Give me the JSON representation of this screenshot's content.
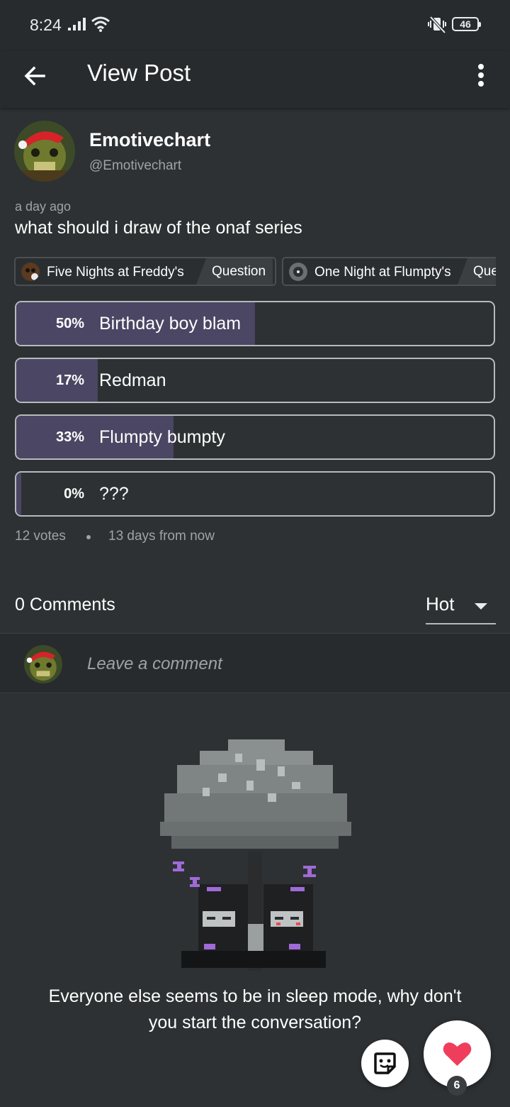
{
  "status_bar": {
    "time": "8:24",
    "battery": "46"
  },
  "appbar": {
    "title": "View Post"
  },
  "author": {
    "name": "Emotivechart",
    "handle": "@Emotivechart"
  },
  "post": {
    "time_ago": "a day ago",
    "title": "what should i draw of the onaf series"
  },
  "tags": [
    {
      "name": "Five Nights at Freddy's",
      "category": "Question"
    },
    {
      "name": "One Night at Flumpty's",
      "category": "Question"
    }
  ],
  "poll": {
    "options": [
      {
        "percent_label": "50%",
        "label": "Birthday boy blam",
        "fraction": 0.5
      },
      {
        "percent_label": "17%",
        "label": "Redman",
        "fraction": 0.17
      },
      {
        "percent_label": "33%",
        "label": "Flumpty bumpty",
        "fraction": 0.33
      },
      {
        "percent_label": "0%",
        "label": "???",
        "fraction": 0.0
      }
    ],
    "votes": "12 votes",
    "ends": "13 days from now"
  },
  "comments": {
    "count_label": "0 Comments",
    "sort_value": "Hot",
    "input_placeholder": "Leave a comment",
    "empty_message": "Everyone else seems to be in sleep mode, why don't you start the conversation?"
  },
  "fab": {
    "like_count": "6"
  },
  "colors": {
    "background": "#2d3133",
    "poll_fill": "#4a4663",
    "like": "#ef3e5c"
  },
  "icons": [
    "back-arrow-icon",
    "more-vert-icon",
    "signal-icon",
    "wifi-icon",
    "vibrate-icon",
    "battery-icon",
    "dropdown-caret-icon",
    "sticker-icon",
    "heart-icon"
  ]
}
